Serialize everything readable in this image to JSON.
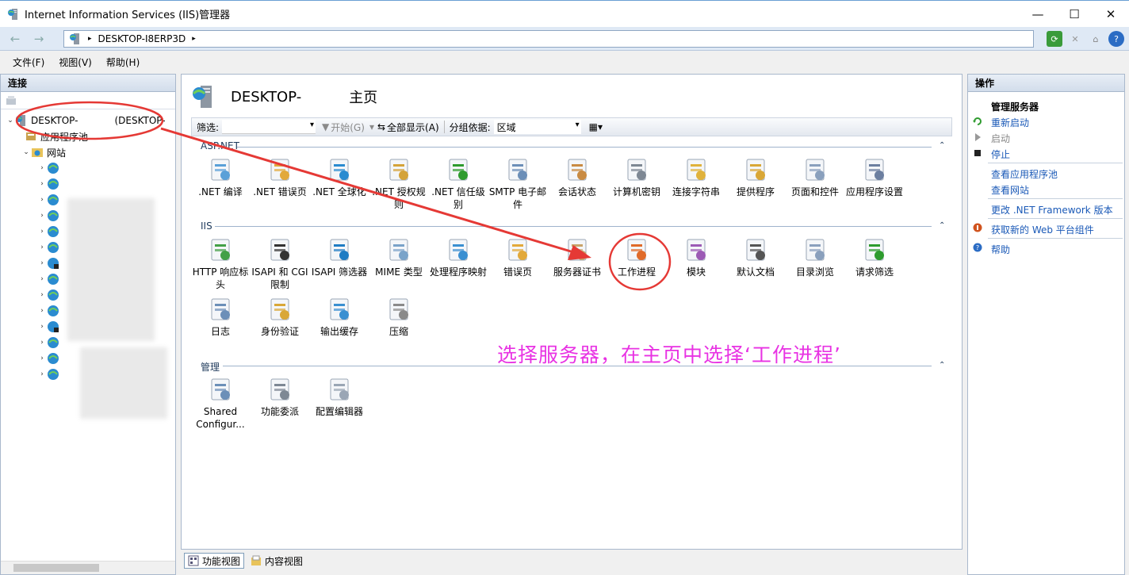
{
  "window": {
    "title": "Internet Information Services (IIS)管理器",
    "minimize": "—",
    "maximize": "☐",
    "close": "✕"
  },
  "address": {
    "back": "←",
    "forward": "→",
    "path": "DESKTOP-I8ERP3D",
    "separator": "▸"
  },
  "menu": [
    "文件(F)",
    "视图(V)",
    "帮助(H)"
  ],
  "left": {
    "header": "连接",
    "server_node_prefix": "DESKTOP-",
    "server_node_suffix": "(DESKTOP-",
    "app_pools": "应用程序池",
    "sites": "网站"
  },
  "center": {
    "title": "DESKTOP-",
    "subtitle": "主页",
    "filter": {
      "label": "筛选:",
      "start": "开始(G)",
      "show_all": "全部显示(A)",
      "group_by": "分组依据:",
      "group_value": "区域"
    },
    "sections": {
      "aspnet": "ASP.NET",
      "iis": "IIS",
      "manage": "管理"
    },
    "aspnet_features": [
      {
        "label": ".NET 编译",
        "icon": "net-compile-icon"
      },
      {
        "label": ".NET 错误页",
        "icon": "net-error-pages-icon"
      },
      {
        "label": ".NET 全球化",
        "icon": "net-globalization-icon"
      },
      {
        "label": ".NET 授权规则",
        "icon": "net-authorization-icon"
      },
      {
        "label": ".NET 信任级别",
        "icon": "net-trust-icon"
      },
      {
        "label": "SMTP 电子邮件",
        "icon": "smtp-email-icon"
      },
      {
        "label": "会话状态",
        "icon": "session-state-icon"
      },
      {
        "label": "计算机密钥",
        "icon": "machine-key-icon"
      },
      {
        "label": "连接字符串",
        "icon": "connection-strings-icon"
      },
      {
        "label": "提供程序",
        "icon": "providers-icon"
      },
      {
        "label": "页面和控件",
        "icon": "pages-controls-icon"
      },
      {
        "label": "应用程序设置",
        "icon": "app-settings-icon"
      }
    ],
    "iis_features": [
      {
        "label": "HTTP 响应标头",
        "icon": "http-headers-icon"
      },
      {
        "label": "ISAPI 和 CGI 限制",
        "icon": "isapi-cgi-icon"
      },
      {
        "label": "ISAPI 筛选器",
        "icon": "isapi-filters-icon"
      },
      {
        "label": "MIME 类型",
        "icon": "mime-types-icon"
      },
      {
        "label": "处理程序映射",
        "icon": "handler-mappings-icon"
      },
      {
        "label": "错误页",
        "icon": "error-pages-icon"
      },
      {
        "label": "服务器证书",
        "icon": "server-certificates-icon"
      },
      {
        "label": "工作进程",
        "icon": "worker-processes-icon"
      },
      {
        "label": "模块",
        "icon": "modules-icon"
      },
      {
        "label": "默认文档",
        "icon": "default-document-icon"
      },
      {
        "label": "目录浏览",
        "icon": "directory-browsing-icon"
      },
      {
        "label": "请求筛选",
        "icon": "request-filtering-icon"
      },
      {
        "label": "日志",
        "icon": "logging-icon"
      },
      {
        "label": "身份验证",
        "icon": "authentication-icon"
      },
      {
        "label": "输出缓存",
        "icon": "output-caching-icon"
      },
      {
        "label": "压缩",
        "icon": "compression-icon"
      }
    ],
    "manage_features": [
      {
        "label": "Shared Configur...",
        "icon": "shared-config-icon"
      },
      {
        "label": "功能委派",
        "icon": "feature-delegation-icon"
      },
      {
        "label": "配置编辑器",
        "icon": "config-editor-icon"
      }
    ]
  },
  "right": {
    "header": "操作",
    "manage_server": "管理服务器",
    "restart": "重新启动",
    "start": "启动",
    "stop": "停止",
    "view_app_pools": "查看应用程序池",
    "view_sites": "查看网站",
    "change_net": "更改 .NET Framework 版本",
    "get_web_components": "获取新的 Web 平台组件",
    "help": "帮助"
  },
  "bottom": {
    "features_view": "功能视图",
    "content_view": "内容视图"
  },
  "annotation": "选择服务器，在主页中选择‘工作进程’",
  "colors": {
    "annotation": "#e832e3",
    "highlight": "#e53935",
    "link": "#1a59b7"
  }
}
